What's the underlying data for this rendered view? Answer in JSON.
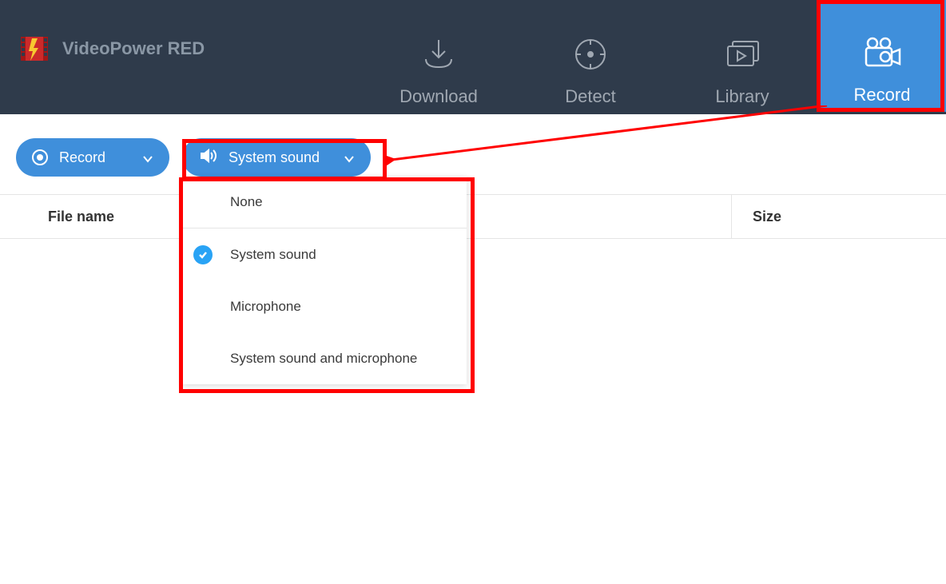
{
  "app": {
    "name": "VideoPower RED"
  },
  "nav": {
    "download": "Download",
    "detect": "Detect",
    "library": "Library",
    "record": "Record"
  },
  "toolbar": {
    "record_label": "Record",
    "sound_label": "System sound"
  },
  "dropdown": {
    "items": [
      {
        "label": "None",
        "selected": false
      },
      {
        "label": "System sound",
        "selected": true
      },
      {
        "label": "Microphone",
        "selected": false
      },
      {
        "label": "System sound and microphone",
        "selected": false
      }
    ]
  },
  "table": {
    "col_filename": "File name",
    "col_size": "Size"
  }
}
